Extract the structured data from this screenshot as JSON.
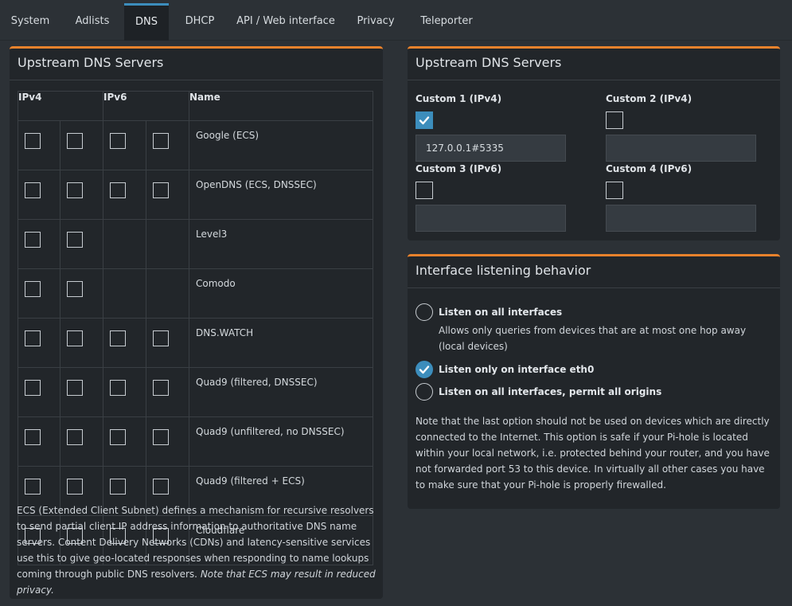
{
  "tabs": [
    "System",
    "Adlists",
    "DNS",
    "DHCP",
    "API / Web interface",
    "Privacy",
    "Teleporter"
  ],
  "left_box": {
    "title": "Upstream DNS Servers",
    "headers": {
      "ipv4": "IPv4",
      "ipv6": "IPv6",
      "name": "Name"
    },
    "rows": [
      {
        "name": "Google (ECS)",
        "v4": [
          false,
          false
        ],
        "v6": [
          false,
          false
        ]
      },
      {
        "name": "OpenDNS (ECS, DNSSEC)",
        "v4": [
          false,
          false
        ],
        "v6": [
          false,
          false
        ]
      },
      {
        "name": "Level3",
        "v4": [
          false,
          false
        ],
        "v6": null
      },
      {
        "name": "Comodo",
        "v4": [
          false,
          false
        ],
        "v6": null
      },
      {
        "name": "DNS.WATCH",
        "v4": [
          false,
          false
        ],
        "v6": [
          false,
          false
        ]
      },
      {
        "name": "Quad9 (filtered, DNSSEC)",
        "v4": [
          false,
          false
        ],
        "v6": [
          false,
          false
        ]
      },
      {
        "name": "Quad9 (unfiltered, no DNSSEC)",
        "v4": [
          false,
          false
        ],
        "v6": [
          false,
          false
        ]
      },
      {
        "name": "Quad9 (filtered + ECS)",
        "v4": [
          false,
          false
        ],
        "v6": [
          false,
          false
        ]
      },
      {
        "name": "Cloudflare",
        "v4": [
          false,
          false
        ],
        "v6": [
          false,
          false
        ]
      }
    ],
    "ecs_note": "ECS (Extended Client Subnet) defines a mechanism for recursive resolvers to send partial client IP address information to authoritative DNS name servers. Content Delivery Networks (CDNs) and latency-sensitive services use this to give geo-located responses when responding to name lookups coming through public DNS resolvers.",
    "ecs_note_italic": "Note that ECS may result in reduced privacy."
  },
  "custom_box": {
    "title": "Upstream DNS Servers",
    "custom1": {
      "label": "Custom 1 (IPv4)",
      "checked": true,
      "value": "127.0.0.1#5335"
    },
    "custom2": {
      "label": "Custom 2 (IPv4)",
      "checked": false,
      "value": ""
    },
    "custom3": {
      "label": "Custom 3 (IPv6)",
      "checked": false,
      "value": ""
    },
    "custom4": {
      "label": "Custom 4 (IPv6)",
      "checked": false,
      "value": ""
    }
  },
  "interface_box": {
    "title": "Interface listening behavior",
    "option1": {
      "label": "Listen on all interfaces",
      "desc": "Allows only queries from devices that are at most one hop away (local devices)",
      "checked": false
    },
    "option2": {
      "label": "Listen only on interface eth0",
      "checked": true
    },
    "option3": {
      "label": "Listen on all interfaces, permit all origins",
      "checked": false
    },
    "note": "Note that the last option should not be used on devices which are directly connected to the Internet. This option is safe if your Pi-hole is located within your local network, i.e. protected behind your router, and you have not forwarded port 53 to this device. In virtually all other cases you have to make sure that your Pi-hole is properly firewalled."
  },
  "colors": {
    "accent": "#3c8dbc",
    "box_border": "#e8822c"
  }
}
